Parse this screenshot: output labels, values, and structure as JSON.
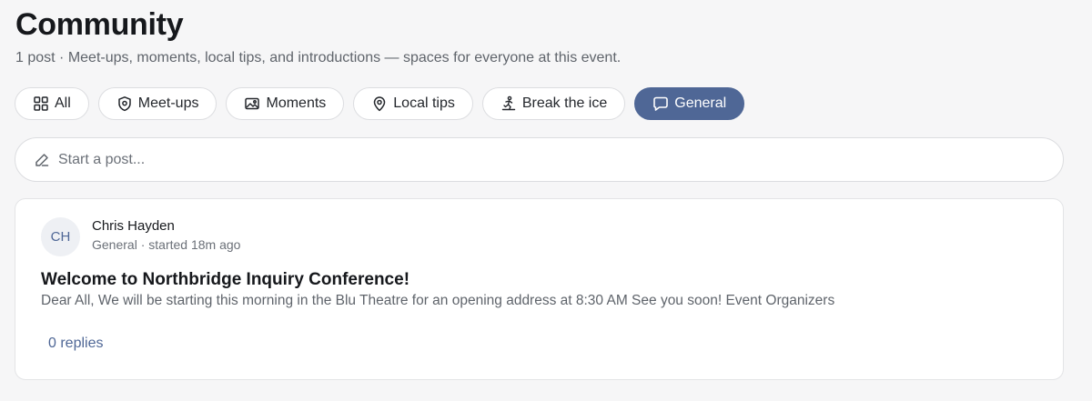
{
  "header": {
    "title": "Community",
    "post_count": "1 post",
    "separator": " · ",
    "description": "Meet-ups, moments, local tips, and introductions — spaces for everyone at this event."
  },
  "filters": [
    {
      "label": "All",
      "icon": "grid-icon",
      "active": false
    },
    {
      "label": "Meet-ups",
      "icon": "location-shield-icon",
      "active": false
    },
    {
      "label": "Moments",
      "icon": "image-icon",
      "active": false
    },
    {
      "label": "Local tips",
      "icon": "map-pin-icon",
      "active": false
    },
    {
      "label": "Break the ice",
      "icon": "ice-skater-icon",
      "active": false
    },
    {
      "label": "General",
      "icon": "chat-bubble-icon",
      "active": true
    }
  ],
  "composer": {
    "placeholder": "Start a post...",
    "icon": "pencil-icon"
  },
  "post": {
    "author_initials": "CH",
    "author_name": "Chris Hayden",
    "category": "General",
    "meta_separator": " · ",
    "started": "started 18m ago",
    "title": "Welcome to Northbridge Inquiry Conference!",
    "body": "Dear All, We will be starting this morning in the Blu Theatre for an opening address at 8:30 AM See you soon! Event Organizers",
    "replies_label": "0 replies"
  },
  "colors": {
    "accent": "#4f6796",
    "background": "#f6f6f7",
    "card": "#ffffff",
    "border": "#dcdde0"
  }
}
